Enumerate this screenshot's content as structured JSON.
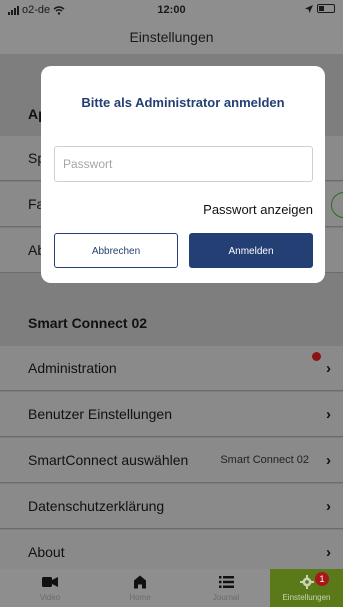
{
  "status_bar": {
    "carrier": "o2-de",
    "time": "12:00"
  },
  "nav_title": "Einstellungen",
  "background_rows": {
    "row1_partial": "Ap",
    "row2_partial": "Sp",
    "row3_partial": "Fa",
    "row4_partial": "Ab"
  },
  "section_header": "Smart Connect 02",
  "settings_rows": [
    {
      "label": "Administration",
      "value": "",
      "has_notification_dot": true
    },
    {
      "label": "Benutzer Einstellungen",
      "value": ""
    },
    {
      "label": "SmartConnect auswählen",
      "value": "Smart Connect 02"
    },
    {
      "label": "Datenschutzerklärung",
      "value": ""
    },
    {
      "label": "About",
      "value": ""
    }
  ],
  "chevron": "›",
  "tabs": [
    {
      "label": "Video",
      "icon": "video-camera-icon"
    },
    {
      "label": "Home",
      "icon": "home-icon"
    },
    {
      "label": "Journal",
      "icon": "list-icon"
    },
    {
      "label": "Einstellungen",
      "icon": "gear-icon",
      "badge": "1",
      "active": true
    }
  ],
  "dialog": {
    "title": "Bitte als Administrator anmelden",
    "password_placeholder": "Passwort",
    "password_value": "",
    "show_password_label": "Passwort anzeigen",
    "cancel_label": "Abbrechen",
    "login_label": "Anmelden"
  },
  "colors": {
    "primary": "#233f73",
    "active_tab": "#5a7a1a",
    "badge": "#a91818"
  }
}
